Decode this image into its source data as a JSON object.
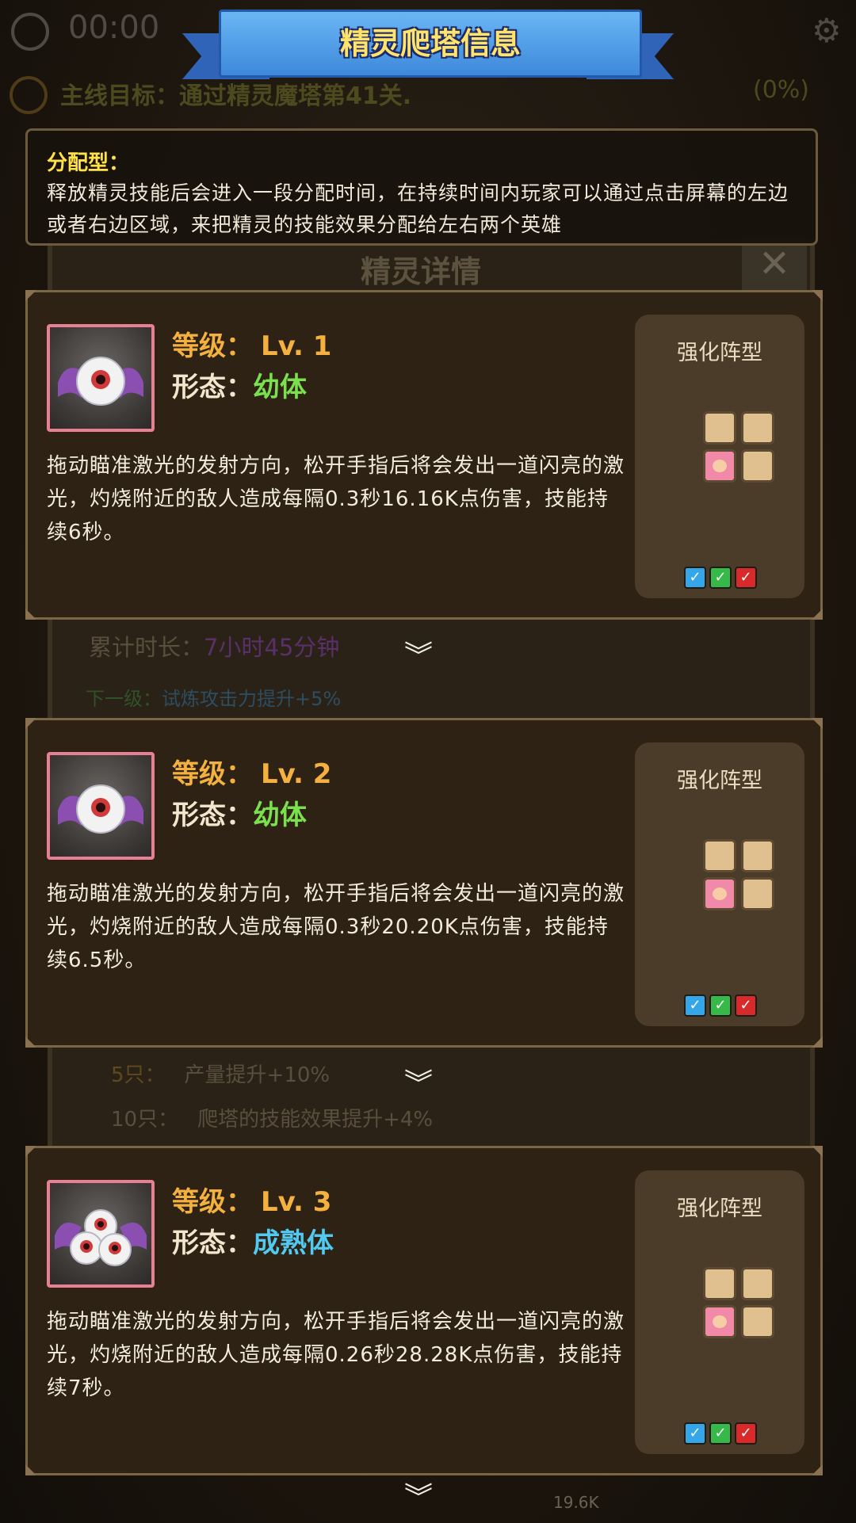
{
  "background": {
    "timer": "00:00",
    "goal_label": "主线目标：通过精灵魔塔第41关.",
    "goal_progress": "(0%)",
    "detail_title": "精灵详情",
    "close_label": "✕",
    "duration_label": "累计时长：",
    "duration_value": "7小时45分钟",
    "next_label": "下一级：",
    "next_value": "试炼攻击力提升+5%",
    "milestone_5_label": "5只：",
    "milestone_5_value": "产量提升+10%",
    "milestone_10_label": "10只：",
    "milestone_10_value": "爬塔的技能效果提升+4%",
    "bottom_value": "19.6K"
  },
  "banner": {
    "title": "精灵爬塔信息"
  },
  "info": {
    "type_label": "分配型：",
    "description": "释放精灵技能后会进入一段分配时间，在持续时间内玩家可以通过点击屏幕的左边或者右边区域，来把精灵的技能效果分配给左右两个英雄"
  },
  "levels": [
    {
      "level_label": "等级：",
      "level_value": "Lv. 1",
      "form_label": "形态：",
      "form_value": "幼体",
      "description": "拖动瞄准激光的发射方向，松开手指后将会发出一道闪亮的激光，灼烧附近的敌人造成每隔0.3秒16.16K点伤害，技能持续6秒。",
      "formation_title": "强化阵型",
      "portrait": "single-eyeball-bat-icon"
    },
    {
      "level_label": "等级：",
      "level_value": "Lv. 2",
      "form_label": "形态：",
      "form_value": "幼体",
      "description": "拖动瞄准激光的发射方向，松开手指后将会发出一道闪亮的激光，灼烧附近的敌人造成每隔0.3秒20.20K点伤害，技能持续6.5秒。",
      "formation_title": "强化阵型",
      "portrait": "single-eyeball-bat-icon"
    },
    {
      "level_label": "等级：",
      "level_value": "Lv. 3",
      "form_label": "形态：",
      "form_value": "成熟体",
      "description": "拖动瞄准激光的发射方向，松开手指后将会发出一道闪亮的激光，灼烧附近的敌人造成每隔0.26秒28.28K点伤害，技能持续7秒。",
      "formation_title": "强化阵型",
      "portrait": "triple-eyeball-bat-icon"
    }
  ],
  "colors": {
    "level_text": "#f5b13f",
    "form_young": "#7be04e",
    "form_mature": "#52c9f0",
    "info_type": "#ffe24a",
    "banner_blue": "#3e89da"
  }
}
